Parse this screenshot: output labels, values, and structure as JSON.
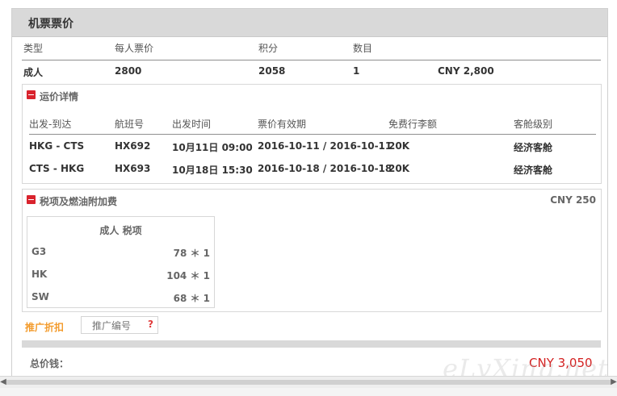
{
  "panel": {
    "title": "机票票价",
    "summary_headers": [
      "类型",
      "每人票价",
      "积分",
      "数目"
    ],
    "summary_row": [
      "成人",
      "2800",
      "2058",
      "1",
      "CNY 2,800"
    ]
  },
  "fare_details": {
    "title": "运价详情",
    "headers": [
      "出发-到达",
      "航班号",
      "出发时间",
      "票价有效期",
      "免费行李额",
      "客舱级别"
    ],
    "rows": [
      [
        "HKG - CTS",
        "HX692",
        "10月11日 09:00",
        "2016-10-11 / 2016-10-11",
        "20K",
        "经济客舱"
      ],
      [
        "CTS - HKG",
        "HX693",
        "10月18日 15:30",
        "2016-10-18 / 2016-10-18",
        "20K",
        "经济客舱"
      ]
    ]
  },
  "taxes": {
    "title": "税项及燃油附加费",
    "total": "CNY 250",
    "table_title": "成人 税项",
    "items": [
      {
        "code": "G3",
        "amount": "78 ＊ 1"
      },
      {
        "code": "HK",
        "amount": "104 ＊ 1"
      },
      {
        "code": "SW",
        "amount": "68 ＊ 1"
      }
    ]
  },
  "promo": {
    "label": "推广折扣",
    "placeholder": "推广编号",
    "help": "?"
  },
  "total": {
    "label": "总价钱：",
    "amount": "CNY 3,050"
  },
  "watermark": "eLvXing.net",
  "icons": {
    "section_toggle": "minus-box-icon",
    "scroll_left": "left-arrow-icon",
    "scroll_right": "right-arrow-icon"
  },
  "colors": {
    "header_bg": "#d9d9d9",
    "accent_red": "#d32020",
    "promo_orange": "#f39b2c",
    "border": "#d8d8d8"
  }
}
